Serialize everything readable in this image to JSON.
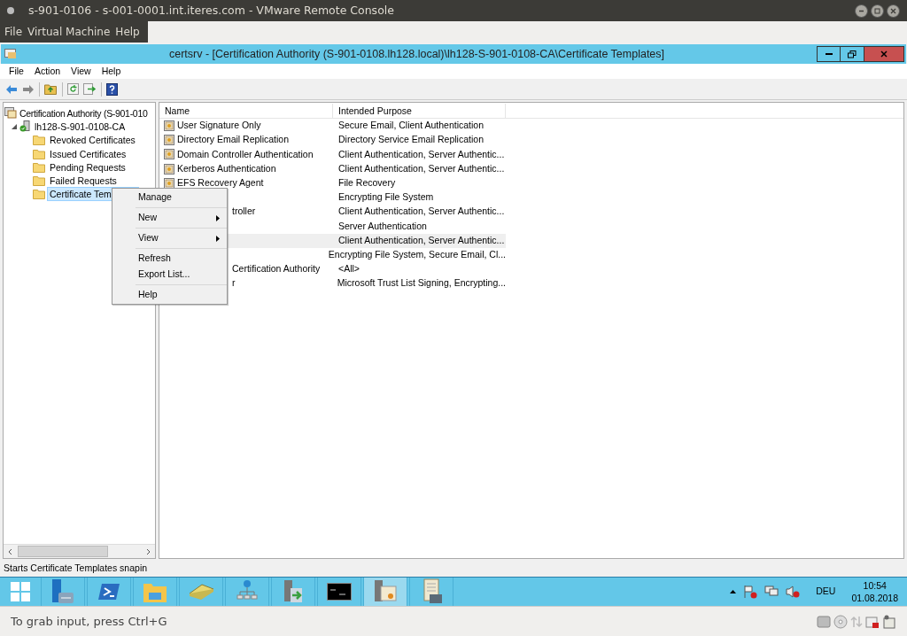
{
  "vm_window": {
    "title": "s-901-0106 - s-001-0001.int.iteres.com - VMware Remote Console",
    "menu": [
      "File",
      "Virtual Machine",
      "Help"
    ],
    "status": "To grab input, press Ctrl+G"
  },
  "mmc": {
    "title": "certsrv - [Certification Authority (S-901-0108.lh128.local)\\lh128-S-901-0108-CA\\Certificate Templates]",
    "menu": [
      "File",
      "Action",
      "View",
      "Help"
    ],
    "tree": [
      {
        "label": "Certification Authority (S-901-010",
        "kind": "root",
        "selected": false,
        "children": [
          {
            "label": "lh128-S-901-0108-CA",
            "kind": "server",
            "expanded": true,
            "selected": false,
            "children": [
              {
                "label": "Revoked Certificates",
                "kind": "folder",
                "selected": false
              },
              {
                "label": "Issued Certificates",
                "kind": "folder",
                "selected": false
              },
              {
                "label": "Pending Requests",
                "kind": "folder",
                "selected": false
              },
              {
                "label": "Failed Requests",
                "kind": "folder",
                "selected": false
              },
              {
                "label": "Certificate Tem",
                "kind": "folder",
                "selected": true
              }
            ]
          }
        ]
      }
    ],
    "list": {
      "columns": [
        "Name",
        "Intended Purpose"
      ],
      "rows": [
        {
          "name": "User Signature Only",
          "purpose": "Secure Email, Client Authentication",
          "hover": false
        },
        {
          "name": "Directory Email Replication",
          "purpose": "Directory Service Email Replication",
          "hover": false
        },
        {
          "name": "Domain Controller Authentication",
          "purpose": "Client Authentication, Server Authentic...",
          "hover": false
        },
        {
          "name": "Kerberos Authentication",
          "purpose": "Client Authentication, Server Authentic...",
          "hover": false
        },
        {
          "name": "EFS Recovery Agent",
          "purpose": "File Recovery",
          "hover": false
        },
        {
          "purpose": "Encrypting File System",
          "hover": false
        },
        {
          "name": "troller",
          "cut": true,
          "purpose": "Client Authentication, Server Authentic...",
          "hover": false
        },
        {
          "purpose": "Server Authentication",
          "hover": false
        },
        {
          "purpose": "Client Authentication, Server Authentic...",
          "hover": true
        },
        {
          "purpose": "Encrypting File System, Secure Email, Cl...",
          "hover": false
        },
        {
          "name": "Certification Authority",
          "cut": true,
          "purpose": "<All>",
          "hover": false
        },
        {
          "name": "r",
          "cut": true,
          "purpose": "Microsoft Trust List Signing, Encrypting...",
          "hover": false
        }
      ]
    },
    "context_menu": [
      [
        {
          "label": "Manage",
          "submenu": false
        }
      ],
      [
        {
          "label": "New",
          "submenu": true
        }
      ],
      [
        {
          "label": "View",
          "submenu": true
        }
      ],
      [
        {
          "label": "Refresh",
          "submenu": false
        },
        {
          "label": "Export List...",
          "submenu": false
        }
      ],
      [
        {
          "label": "Help",
          "submenu": false
        }
      ]
    ],
    "status_bar": "Starts Certificate Templates snapin"
  },
  "taskbar": {
    "apps": [
      {
        "kind": "server-manager",
        "active": false
      },
      {
        "kind": "powershell",
        "active": false
      },
      {
        "kind": "explorer",
        "active": false
      },
      {
        "kind": "book",
        "active": false
      },
      {
        "kind": "network",
        "active": false
      },
      {
        "kind": "server-arrow",
        "active": false
      },
      {
        "kind": "terminal",
        "active": false
      },
      {
        "kind": "cert-server",
        "active": true
      },
      {
        "kind": "scroll",
        "active": false
      }
    ],
    "language": "DEU",
    "time": "10:54",
    "date": "01.08.2018"
  }
}
